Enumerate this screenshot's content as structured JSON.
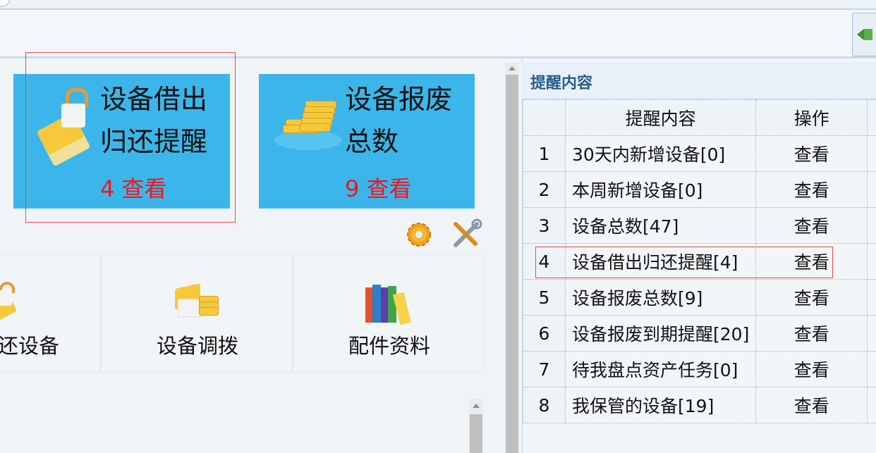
{
  "tiles": [
    {
      "title_line1": "设备借出",
      "title_line2": "归还提醒",
      "count": "4",
      "action": "查看"
    },
    {
      "title_line1": "设备报废",
      "title_line2": "总数",
      "count": "9",
      "action": "查看"
    }
  ],
  "modules": [
    {
      "label": "还设备",
      "icon": "lock-cards-icon"
    },
    {
      "label": "设备调拨",
      "icon": "transfer-icon"
    },
    {
      "label": "配件资料",
      "icon": "books-icon"
    }
  ],
  "tool_icons": [
    "gear-icon",
    "tools-icon"
  ],
  "reminder_panel": {
    "title": "提醒内容",
    "columns": [
      "提醒内容",
      "操作"
    ],
    "rows": [
      {
        "num": "1",
        "content": "30天内新增设备[0]",
        "action": "查看"
      },
      {
        "num": "2",
        "content": "本周新增设备[0]",
        "action": "查看"
      },
      {
        "num": "3",
        "content": "设备总数[47]",
        "action": "查看"
      },
      {
        "num": "4",
        "content": "设备借出归还提醒[4]",
        "action": "查看"
      },
      {
        "num": "5",
        "content": "设备报废总数[9]",
        "action": "查看"
      },
      {
        "num": "6",
        "content": "设备报废到期提醒[20]",
        "action": "查看"
      },
      {
        "num": "7",
        "content": "待我盘点资产任务[0]",
        "action": "查看"
      },
      {
        "num": "8",
        "content": "我保管的设备[19]",
        "action": "查看"
      }
    ]
  },
  "colors": {
    "tile_bg": "#3cb6ea",
    "count_red": "#f0171a",
    "highlight_red": "#e24a4a",
    "panel_title": "#2a5d8a"
  }
}
